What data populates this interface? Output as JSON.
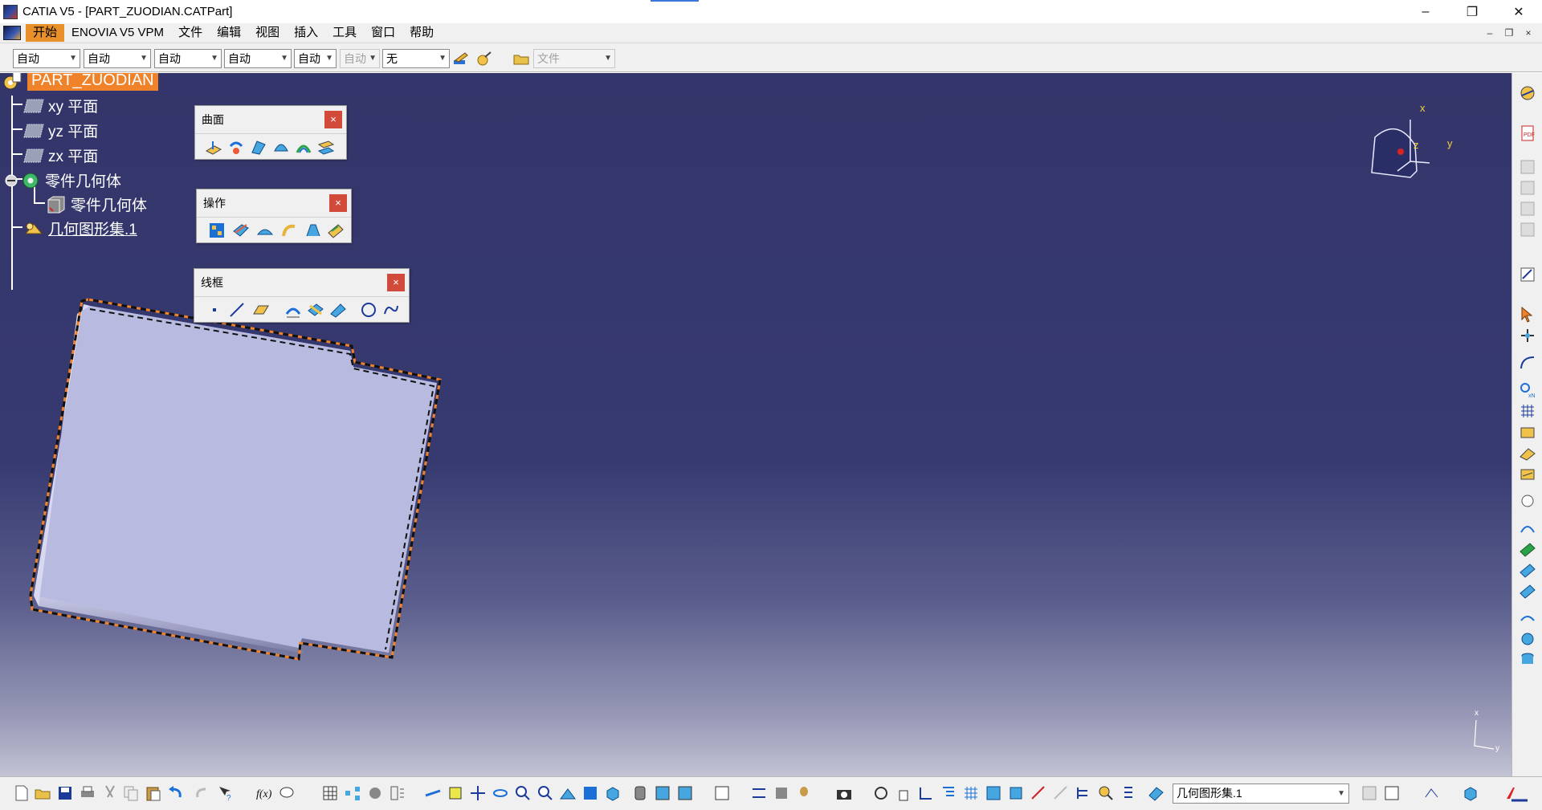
{
  "window": {
    "title": "CATIA V5 - [PART_ZUODIAN.CATPart]",
    "minimize": "–",
    "restore": "❐",
    "close": "✕"
  },
  "menu": {
    "items": [
      "开始",
      "ENOVIA V5 VPM",
      "文件",
      "编辑",
      "视图",
      "插入",
      "工具",
      "窗口",
      "帮助"
    ]
  },
  "toolbar_top": {
    "combos": [
      "自动",
      "自动",
      "自动",
      "自动",
      "自动",
      "自动",
      "无"
    ],
    "file_combo": "文件"
  },
  "tree": {
    "root": "PART_ZUODIAN",
    "nodes": [
      "xy 平面",
      "yz 平面",
      "zx 平面",
      "零件几何体",
      "零件几何体",
      "几何图形集.1"
    ]
  },
  "floating_toolbars": [
    {
      "title": "曲面",
      "close": "×"
    },
    {
      "title": "操作",
      "close": "×"
    },
    {
      "title": "线框",
      "close": "×"
    }
  ],
  "compass": {
    "x": "x",
    "y": "y",
    "z": "z"
  },
  "mini_axis": {
    "x": "x",
    "y": "y"
  },
  "bottom_toolbar": {
    "geom_set_combo": "几何图形集.1"
  },
  "colors": {
    "viewport_top": "#34356a",
    "selection_orange": "#f0822a",
    "part_face": "#b9bae0"
  }
}
